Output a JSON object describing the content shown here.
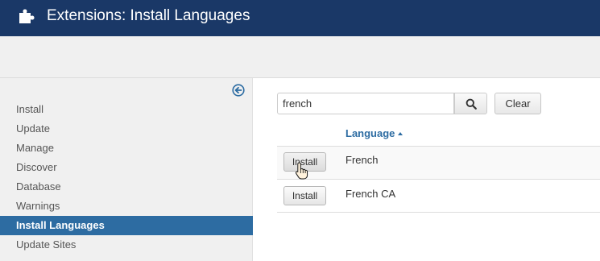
{
  "header": {
    "title": "Extensions: Install Languages",
    "icon": "puzzle-icon",
    "background": "#1a3867"
  },
  "sidebar": {
    "collapse_icon": "collapse-left-icon",
    "items": [
      {
        "label": "Install"
      },
      {
        "label": "Update"
      },
      {
        "label": "Manage"
      },
      {
        "label": "Discover"
      },
      {
        "label": "Database"
      },
      {
        "label": "Warnings"
      },
      {
        "label": "Install Languages",
        "active": true
      },
      {
        "label": "Update Sites"
      }
    ],
    "active_color": "#2d6ca2"
  },
  "filter": {
    "search_value": "french",
    "search_icon": "search-icon",
    "clear_label": "Clear"
  },
  "table": {
    "column_language": "Language",
    "sort": "ascending",
    "rows": [
      {
        "action_label": "Install",
        "language": "French"
      },
      {
        "action_label": "Install",
        "language": "French CA"
      }
    ]
  },
  "pointer": "hand-cursor-icon"
}
